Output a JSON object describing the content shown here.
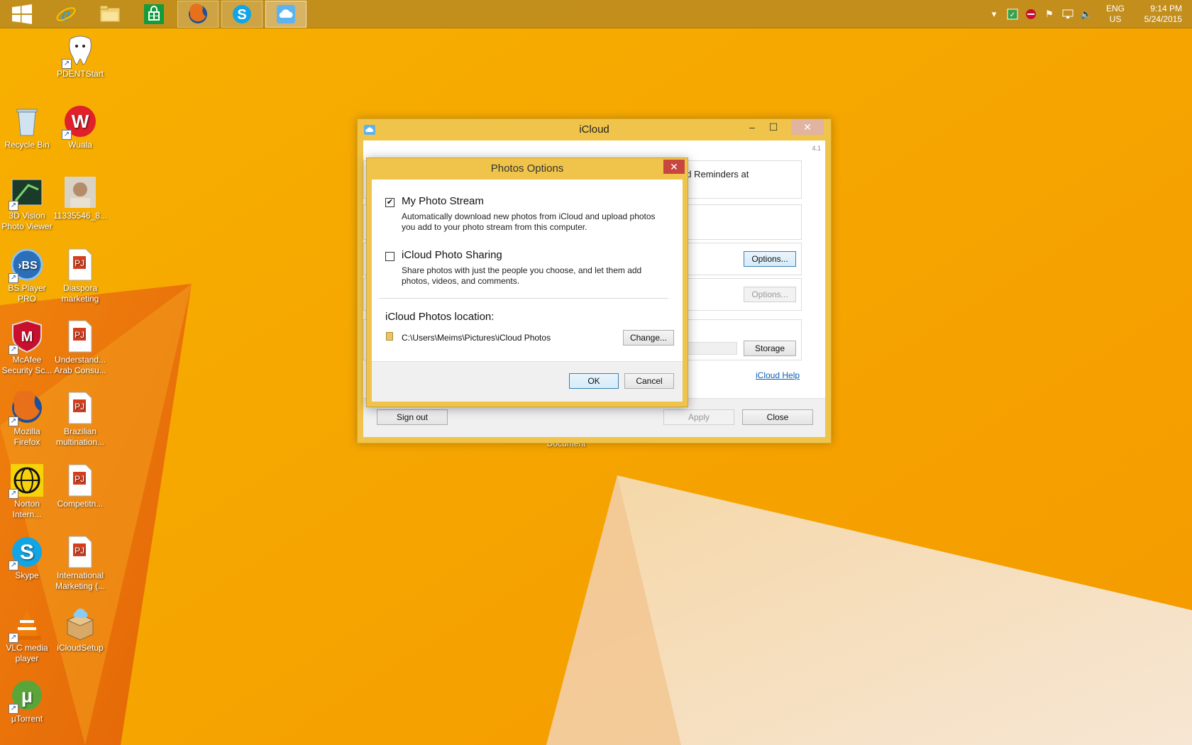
{
  "taskbar": {
    "apps": [
      {
        "name": "start-button",
        "icon": "windows-logo-icon"
      },
      {
        "name": "internet-explorer",
        "icon": "ie-icon"
      },
      {
        "name": "file-explorer",
        "icon": "folder-icon"
      },
      {
        "name": "store",
        "icon": "store-icon"
      },
      {
        "name": "firefox",
        "icon": "firefox-icon"
      },
      {
        "name": "skype",
        "icon": "skype-icon"
      },
      {
        "name": "icloud",
        "icon": "icloud-icon"
      }
    ],
    "lang_top": "ENG",
    "lang_bottom": "US",
    "time": "9:14 PM",
    "date": "5/24/2015"
  },
  "desktop": {
    "icons": [
      {
        "label": "PDENTStart"
      },
      {
        "label": "Recycle Bin"
      },
      {
        "label": "Wuala"
      },
      {
        "label": "3D Vision Photo Viewer"
      },
      {
        "label": "11335546_8..."
      },
      {
        "label": "BS.Player PRO"
      },
      {
        "label": "Diaspora marketing"
      },
      {
        "label": "McAfee Security Sc..."
      },
      {
        "label": "Understand... Arab Consu..."
      },
      {
        "label": "Mozilla Firefox"
      },
      {
        "label": "Brazilian multination..."
      },
      {
        "label": "Norton Intern..."
      },
      {
        "label": "Competitn..."
      },
      {
        "label": "Skype"
      },
      {
        "label": "International Marketing (..."
      },
      {
        "label": "VLC media player"
      },
      {
        "label": "iCloudSetup"
      },
      {
        "label": "µTorrent"
      }
    ],
    "hidden_label": "Document"
  },
  "icloud_window": {
    "title": "iCloud",
    "version": "4.1",
    "partial_text": "nd Reminders at",
    "options_label": "Options...",
    "options2_label": "Options...",
    "storage_label": "Storage",
    "help_link": "iCloud Help",
    "sign_out": "Sign out",
    "apply": "Apply",
    "close": "Close"
  },
  "photos_dialog": {
    "title": "Photos Options",
    "photo_stream": {
      "label": "My Photo Stream",
      "checked": true,
      "desc": "Automatically download new photos from iCloud and upload photos you add to your photo stream from this computer."
    },
    "photo_sharing": {
      "label": "iCloud Photo Sharing",
      "checked": false,
      "desc": "Share photos with just the people you choose, and let them add photos, videos, and comments."
    },
    "location_label": "iCloud Photos location:",
    "location_path": "C:\\Users\\Meims\\Pictures\\iCloud Photos",
    "change_label": "Change...",
    "ok_label": "OK",
    "cancel_label": "Cancel"
  }
}
